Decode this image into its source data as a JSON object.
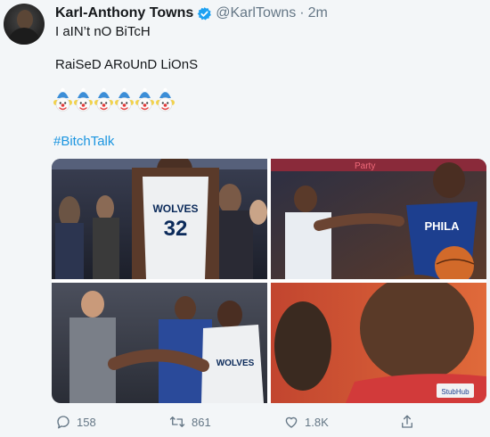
{
  "tweet": {
    "author_name": "Karl-Anthony Towns",
    "handle": "@KarlTowns",
    "separator": "·",
    "time": "2m",
    "lines": [
      "I aIN’t nO BiTcH",
      "RaiSeD ARoUnD LiOnS"
    ],
    "emoji_name": "clown-emoji",
    "emoji_count": 6,
    "hashtag": "#BitchTalk"
  },
  "media": {
    "photos": [
      {
        "name": "photo-towns-wolves-32",
        "jersey_text": "WOLVES",
        "jersey_number": "32"
      },
      {
        "name": "photo-embiid-philadelphia",
        "jersey_text": "PHILA"
      },
      {
        "name": "photo-towns-restrained",
        "jersey_text": "WOLVES"
      },
      {
        "name": "photo-embiid-closeup",
        "patch_text": "StubHub"
      }
    ],
    "arena_sign": "Party"
  },
  "actions": {
    "reply_count": "158",
    "retweet_count": "861",
    "like_count": "1.8K"
  },
  "colors": {
    "link": "#1b95e0",
    "secondary_text": "#657786",
    "verified": "#1da1f2"
  }
}
